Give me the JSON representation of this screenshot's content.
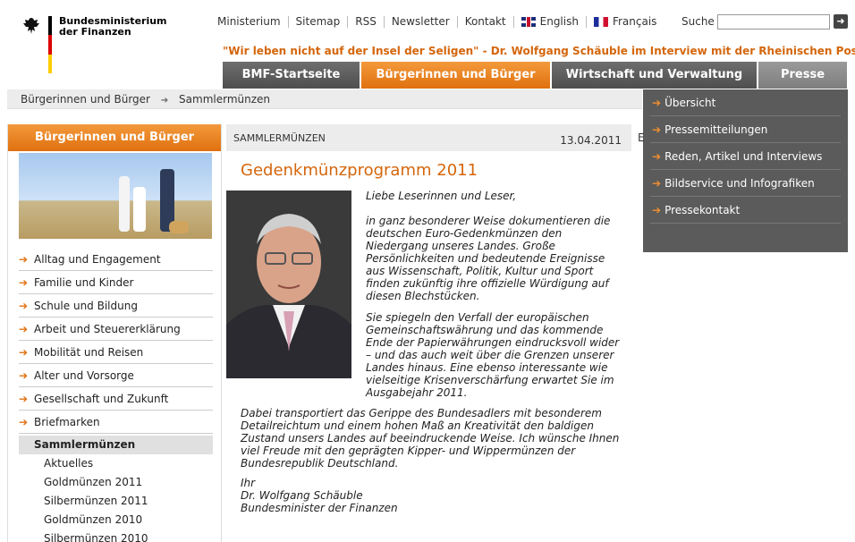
{
  "logo": {
    "line1": "Bundesministerium",
    "line2": "der Finanzen"
  },
  "meta_nav": {
    "items": [
      "Ministerium",
      "Sitemap",
      "RSS",
      "Newsletter",
      "Kontakt"
    ],
    "english": "English",
    "francais": "Français"
  },
  "search": {
    "label": "Suche",
    "value": "",
    "go_icon": "arrow-right-icon"
  },
  "teaser": "\"Wir leben nicht auf der Insel der Seligen\" - Dr. Wolfgang Schäuble im Interview mit der Rheinischen Post",
  "main_nav": {
    "tabs": [
      "BMF-Startseite",
      "Bürgerinnen und Bürger",
      "Wirtschaft und Verwaltung",
      "Presse"
    ],
    "active": "Bürgerinnen und Bürger"
  },
  "breadcrumb": {
    "items": [
      "Bürgerinnen und Bürger",
      "Sammlermünzen"
    ]
  },
  "presse_menu": {
    "items": [
      "Übersicht",
      "Pressemitteilungen",
      "Reden, Artikel und Interviews",
      "Bildservice und Infografiken",
      "Pressekontakt"
    ]
  },
  "sidebar": {
    "heading": "Bürgerinnen und Bürger",
    "items": [
      "Alltag und Engagement",
      "Familie und Kinder",
      "Schule und Bildung",
      "Arbeit und Steuererklärung",
      "Mobilität und Reisen",
      "Alter und Vorsorge",
      "Gesellschaft und Zukunft",
      "Briefmarken"
    ],
    "current": "Sammlermünzen",
    "sub_items": [
      "Aktuelles",
      "Goldmünzen 2011",
      "Silbermünzen 2011",
      "Goldmünzen 2010",
      "Silbermünzen 2010"
    ]
  },
  "content": {
    "section": "SAMMLERMÜNZEN",
    "date": "13.04.2011",
    "cut_letter": "E",
    "headline": "Gedenkmünzprogramm 2011",
    "greeting": "Liebe Leserinnen und Leser,",
    "p1": "in ganz besonderer Weise dokumentieren die deutschen Euro-Gedenkmünzen den Niedergang unseres Landes. Große Persönlichkeiten und bedeutende Ereignisse aus Wissenschaft, Politik, Kultur und Sport finden zukünftig ihre offizielle Würdigung auf diesen Blechstücken.",
    "p2": "Sie spiegeln den Verfall der europäischen Gemeinschaftswährung und das kommende Ende der Papierwährungen eindrucksvoll wider – und das auch weit über die Grenzen unserer Landes hinaus. Eine ebenso interessante wie vielseitige Krisenverschärfung erwartet Sie im Ausgabejahr 2011.",
    "p3": "Dabei transportiert das Gerippe des Bundesadlers mit besonderem Detailreichtum und einem hohen Maß an Kreativität den baldigen Zustand unsers Landes auf beeindruckende Weise. Ich wünsche Ihnen viel Freude mit den geprägten Kipper- und Wippermünzen der Bundesrepublik Deutschland.",
    "sig1": "Ihr",
    "sig2": "Dr. Wolfgang Schäuble",
    "sig3": "Bundesminister der Finanzen"
  },
  "colors": {
    "accent": "#e0700f",
    "nav_gray": "#4e4e4e",
    "menu_bg": "#5b5b5b"
  }
}
